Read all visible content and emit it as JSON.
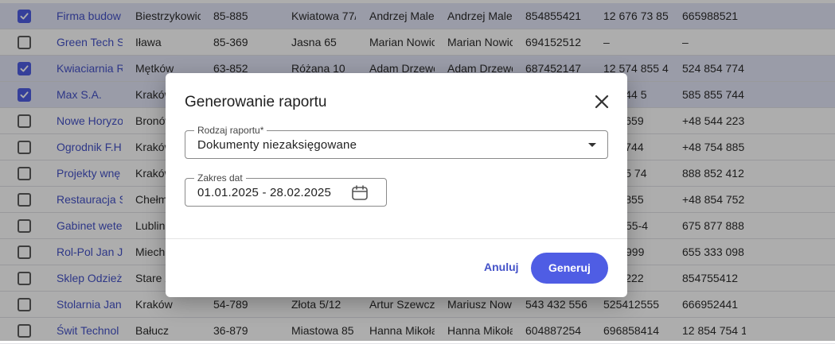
{
  "table": {
    "rows": [
      {
        "selected": true,
        "name": "Firma budow",
        "city": "Biestrzykowic",
        "zip": "85-885",
        "street": "Kwiatowa 77/",
        "person1": "Andrzej Male",
        "person2": "Andrzej Male",
        "nip": "854855421",
        "phone1": "12 676 73 85",
        "phone2": "665988521"
      },
      {
        "selected": false,
        "name": "Green Tech S",
        "city": "Iława",
        "zip": "85-369",
        "street": "Jasna 65",
        "person1": "Marian Nowic",
        "person2": "Marian Nowic",
        "nip": "694152512",
        "phone1": "–",
        "phone2": "–"
      },
      {
        "selected": true,
        "name": "Kwiaciarnia R",
        "city": "Mętków",
        "zip": "63-852",
        "street": "Różana 10",
        "person1": "Adam Drzewc",
        "person2": "Adam Drzewc",
        "nip": "687452147",
        "phone1": "12 574 855 4",
        "phone2": "524 854 774"
      },
      {
        "selected": true,
        "name": "Max S.A.",
        "city": "Kraków",
        "zip": "",
        "street": "",
        "person1": "",
        "person2": "",
        "nip": "",
        "phone1": "85 744 5",
        "phone2": "585 855 744"
      },
      {
        "selected": false,
        "name": "Nowe Horyzo",
        "city": "Bronów",
        "zip": "",
        "street": "",
        "person1": "",
        "person2": "",
        "nip": "",
        "phone1": "475 659",
        "phone2": "+48 544 223"
      },
      {
        "selected": false,
        "name": "Ogrodnik F.H.",
        "city": "Kraków",
        "zip": "",
        "street": "",
        "person1": "",
        "person2": "",
        "nip": "",
        "phone1": "588 744",
        "phone2": "+48 754 885"
      },
      {
        "selected": false,
        "name": "Projekty wnę",
        "city": "Kraków",
        "zip": "",
        "street": "",
        "person1": "",
        "person2": "",
        "nip": "",
        "phone1": "24 85 74",
        "phone2": "888 852 412"
      },
      {
        "selected": false,
        "name": "Restauracja S",
        "city": "Chełm",
        "zip": "",
        "street": "",
        "person1": "",
        "person2": "",
        "nip": "",
        "phone1": "544 855",
        "phone2": "+48 854 752"
      },
      {
        "selected": false,
        "name": "Gabinet wete",
        "city": "Lublin",
        "zip": "",
        "street": "",
        "person1": "",
        "person2": "",
        "nip": "",
        "phone1": "555-55-4",
        "phone2": "675 877 888"
      },
      {
        "selected": false,
        "name": "Rol-Pol Jan J",
        "city": "Miech",
        "zip": "",
        "street": "",
        "person1": "",
        "person2": "",
        "nip": "",
        "phone1": "777-999",
        "phone2": "655 333 098"
      },
      {
        "selected": false,
        "name": "Sklep Odzież",
        "city": "Stare Z",
        "zip": "",
        "street": "",
        "person1": "",
        "person2": "",
        "nip": "",
        "phone1": "745 222",
        "phone2": "854755412"
      },
      {
        "selected": false,
        "name": "Stolarnia Jan",
        "city": "Kraków",
        "zip": "54-789",
        "street": "Złota 5/12",
        "person1": "Artur Szewcz",
        "person2": "Mariusz Now",
        "nip": "543 432 556",
        "phone1": "525412555",
        "phone2": "666952441"
      },
      {
        "selected": false,
        "name": "Świt Technol",
        "city": "Bałucz",
        "zip": "36-879",
        "street": "Miastowa 85",
        "person1": "Hanna Mikoła",
        "person2": "Hanna Mikoła",
        "nip": "604887254",
        "phone1": "696858414",
        "phone2": "12 854 754 1"
      }
    ]
  },
  "dialog": {
    "title": "Generowanie raportu",
    "report_type": {
      "label": "Rodzaj raportu*",
      "value": "Dokumenty niezaksięgowane"
    },
    "date_range": {
      "label": "Zakres dat",
      "value": "01.01.2025 - 28.02.2025"
    },
    "cancel_label": "Anuluj",
    "generate_label": "Generuj"
  },
  "colors": {
    "accent": "#4f5de4",
    "selected_row": "#e4e6f8",
    "link": "#4452c8"
  },
  "icons": {
    "close": "close-icon",
    "calendar": "calendar-icon",
    "dropdown": "chevron-down-icon",
    "checkbox": "check-icon"
  }
}
